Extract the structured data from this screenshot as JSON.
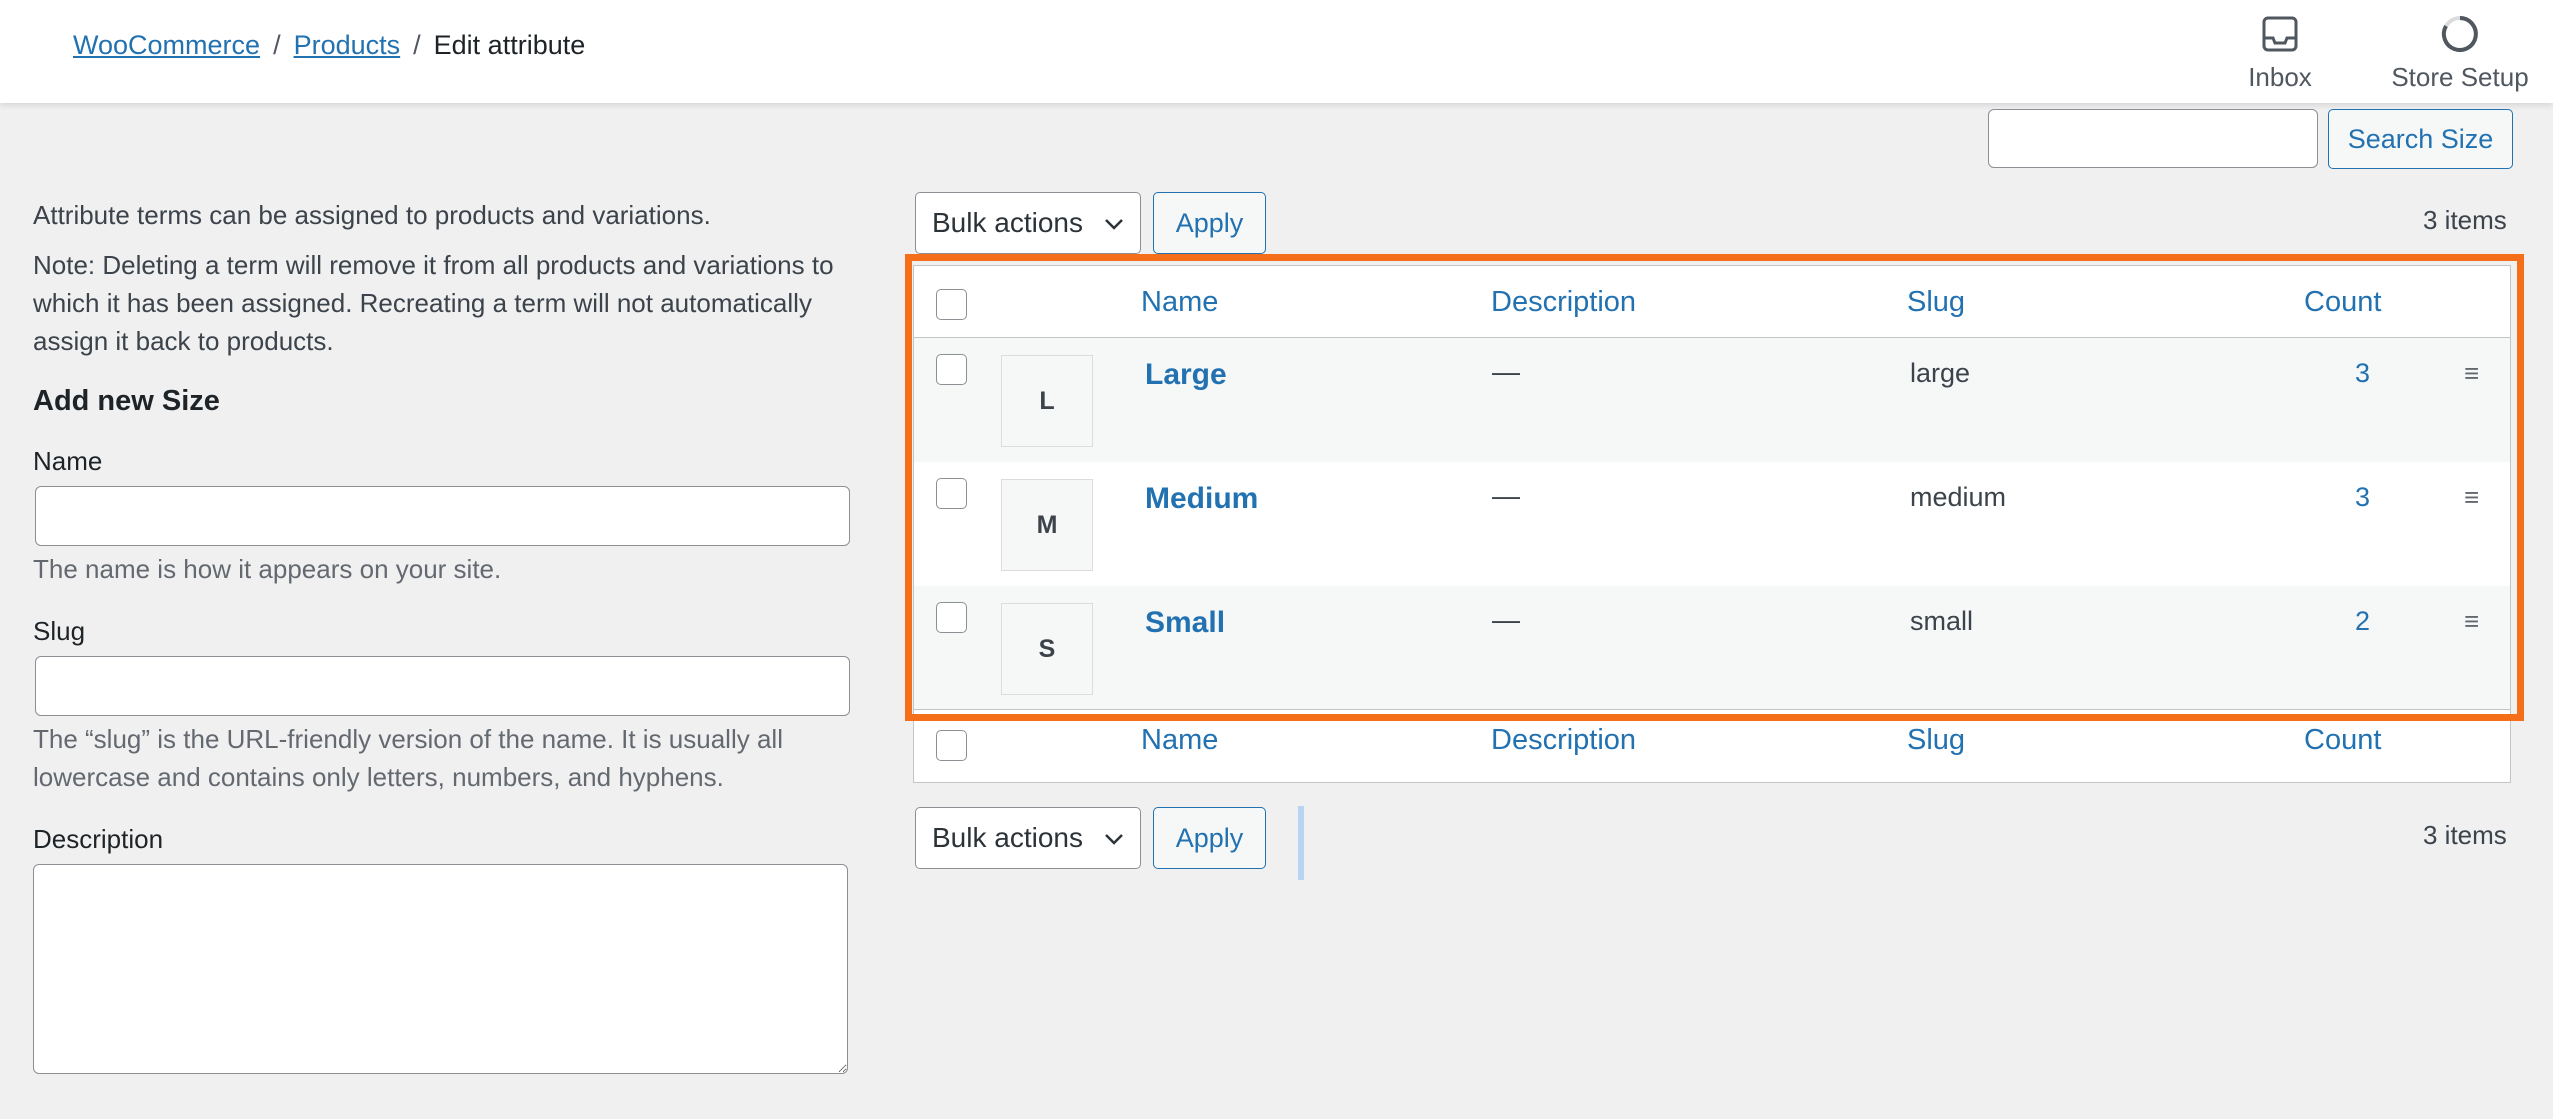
{
  "breadcrumb": {
    "items": [
      "WooCommerce",
      "Products"
    ],
    "separator": "/",
    "current": "Edit attribute"
  },
  "header_actions": [
    {
      "label": "Inbox",
      "icon": "inbox-icon"
    },
    {
      "label": "Store Setup",
      "icon": "progress-ring-icon"
    }
  ],
  "left_panel": {
    "intro": "Attribute terms can be assigned to products and variations.",
    "note": "Note: Deleting a term will remove it from all products and variations to which it has been assigned. Recreating a term will not automatically assign it back to products.",
    "heading": "Add new Size",
    "name_label": "Name",
    "name_help": "The name is how it appears on your site.",
    "slug_label": "Slug",
    "slug_help": "The “slug” is the URL-friendly version of the name. It is usually all lowercase and contains only letters, numbers, and hyphens.",
    "description_label": "Description"
  },
  "search": {
    "button_label": "Search Size",
    "value": ""
  },
  "bulk": {
    "select_label": "Bulk actions",
    "apply_label": "Apply",
    "items_count": "3 items"
  },
  "table": {
    "columns": {
      "name": "Name",
      "description": "Description",
      "slug": "Slug",
      "count": "Count"
    },
    "rows": [
      {
        "swatch": "L",
        "name": "Large",
        "description": "—",
        "slug": "large",
        "count": "3"
      },
      {
        "swatch": "M",
        "name": "Medium",
        "description": "—",
        "slug": "medium",
        "count": "3"
      },
      {
        "swatch": "S",
        "name": "Small",
        "description": "—",
        "slug": "small",
        "count": "2"
      }
    ]
  },
  "colors": {
    "accent": "#2271b1",
    "highlight": "#f56e19",
    "background": "#f0f0f1"
  }
}
